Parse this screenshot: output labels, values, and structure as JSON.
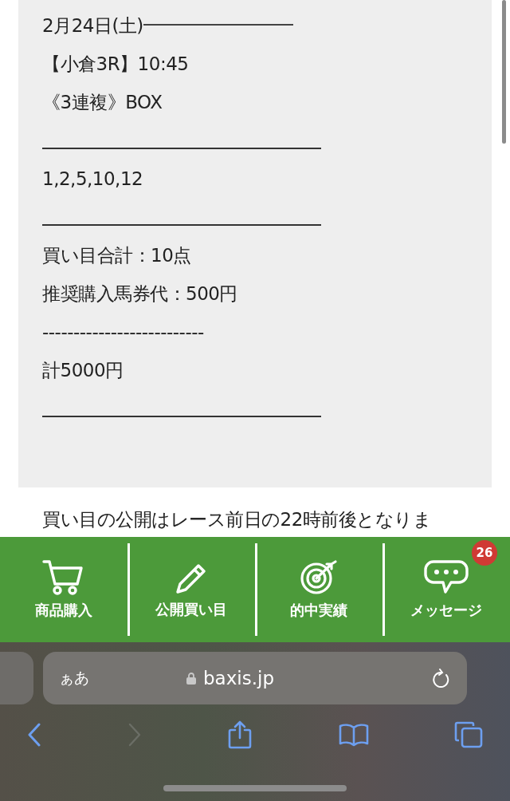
{
  "post": {
    "lines": [
      {
        "kind": "dated",
        "text": "2月24日(土)"
      },
      {
        "kind": "text",
        "text": "【小倉3R】10:45"
      },
      {
        "kind": "text",
        "text": "《3連複》BOX"
      },
      {
        "kind": "rule"
      },
      {
        "kind": "text",
        "text": "1,2,5,10,12"
      },
      {
        "kind": "rule"
      },
      {
        "kind": "text",
        "text": "買い目合計：10点"
      },
      {
        "kind": "text",
        "text": "推奨購入馬券代：500円"
      },
      {
        "kind": "text",
        "text": "--------------------------"
      },
      {
        "kind": "text",
        "text": "計5000円"
      },
      {
        "kind": "rule"
      }
    ],
    "note": "買い目の公開はレース前日の22時前後となりま"
  },
  "nav": [
    {
      "kind": "cart",
      "label": "商品購入"
    },
    {
      "kind": "pencil",
      "label": "公開買い目"
    },
    {
      "kind": "target",
      "label": "的中実績"
    },
    {
      "kind": "chat",
      "label": "メッセージ",
      "badge": "26"
    }
  ],
  "browser": {
    "text_size": "ぁあ",
    "url": "baxis.jp",
    "forward_disabled": true
  }
}
